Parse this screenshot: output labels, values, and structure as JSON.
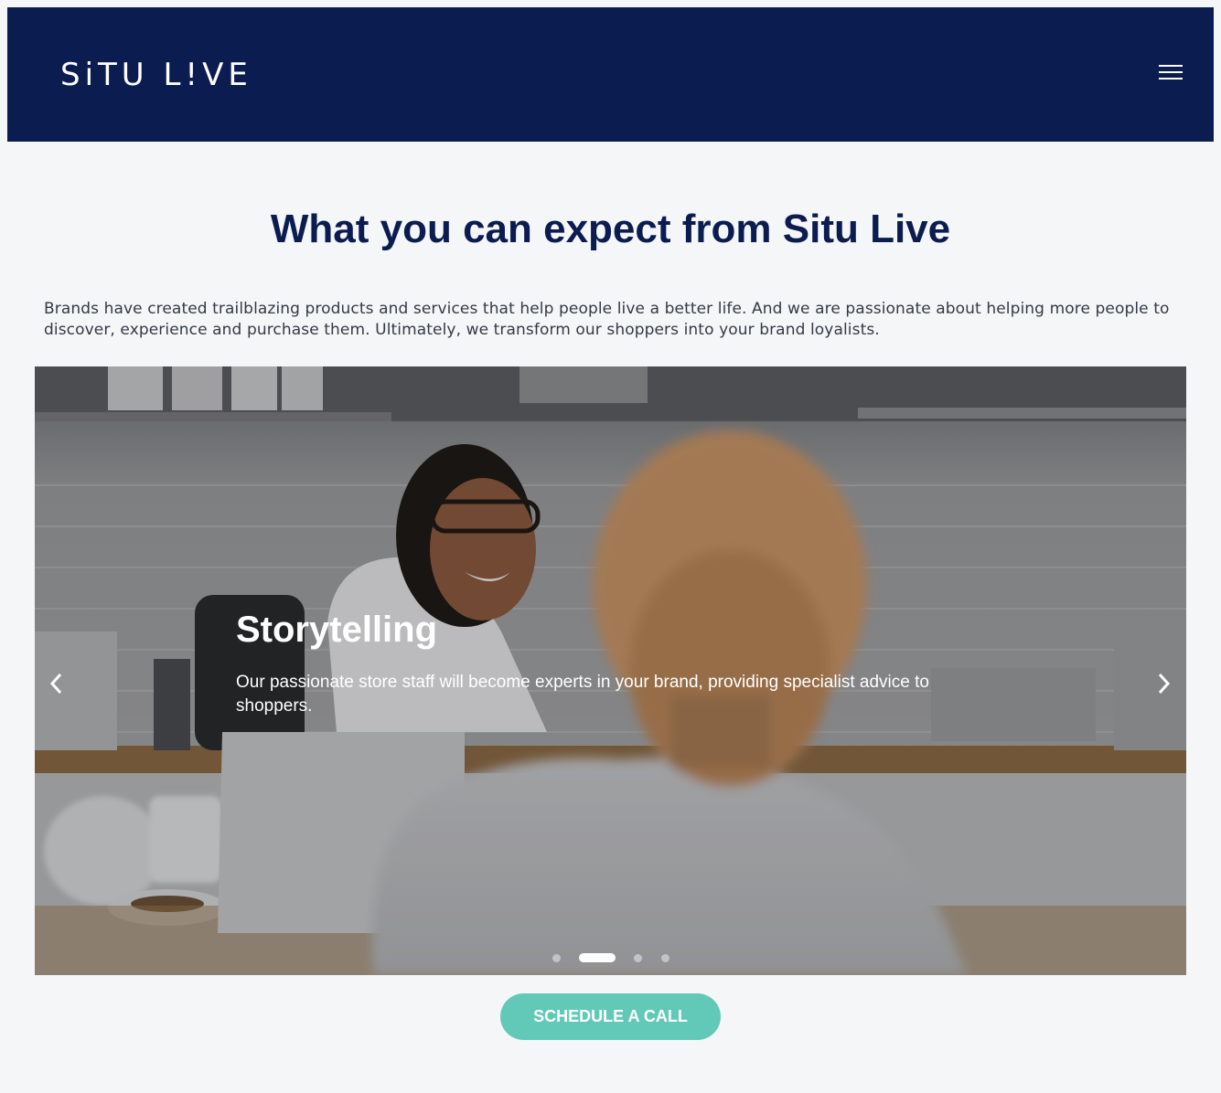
{
  "header": {
    "logo_text": "SiTU L!VE",
    "menu_icon": "hamburger-menu-icon",
    "background": "#0b1c50"
  },
  "section": {
    "heading": "What you can expect from Situ Live",
    "intro": "Brands have created trailblazing products and services that help people live a better life. And we are passionate about helping more people to discover, experience and purchase them. Ultimately, we transform our shoppers into your brand loyalists."
  },
  "carousel": {
    "slide": {
      "title": "Storytelling",
      "text": "Our passionate store staff will become experts in your brand, providing specialist advice to shoppers."
    },
    "prev_icon": "chevron-left-icon",
    "next_icon": "chevron-right-icon",
    "slide_count": 4,
    "active_index": 1
  },
  "cta": {
    "label": "Schedule a call",
    "color": "#62c9b8"
  }
}
